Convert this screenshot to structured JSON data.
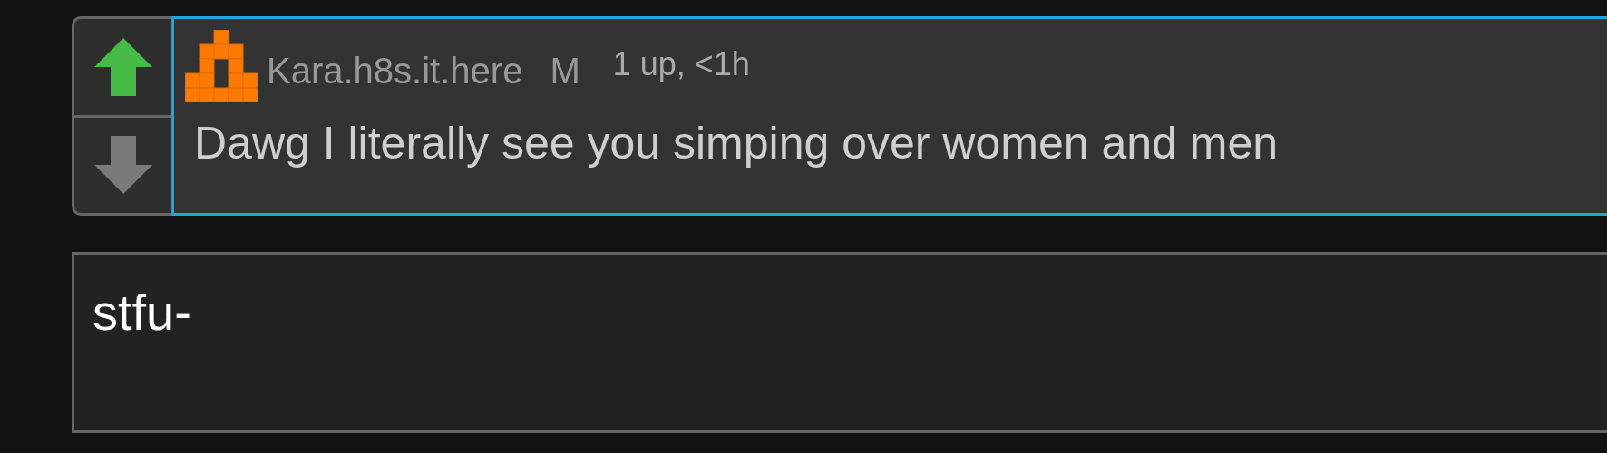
{
  "comment": {
    "upvoted": true,
    "downvoted": false,
    "username": "Kara.h8s.it.here",
    "flair": "M",
    "meta": "1 up, <1h",
    "text": "Dawg I literally see you simping over women and men",
    "highlighted": true
  },
  "reply": {
    "value": "stfu-"
  }
}
